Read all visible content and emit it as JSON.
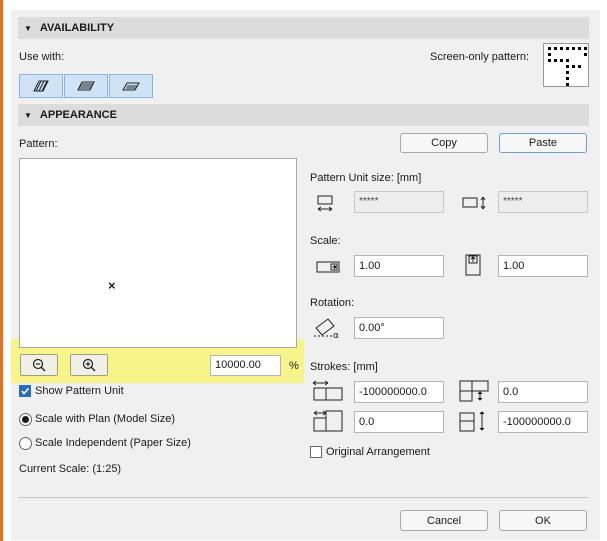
{
  "availability": {
    "header": "AVAILABILITY",
    "use_with_label": "Use with:",
    "use_with_icons": [
      "fill-cut-icon",
      "fill-cover-icon",
      "fill-surface-icon"
    ],
    "screen_only_label": "Screen-only pattern:"
  },
  "appearance": {
    "header": "APPEARANCE",
    "pattern_label": "Pattern:",
    "copy_label": "Copy",
    "paste_label": "Paste",
    "zoom_value": "10000.00",
    "zoom_unit": "%",
    "show_pattern_unit": "Show Pattern Unit",
    "scale_with_plan": "Scale with Plan (Model Size)",
    "scale_independent": "Scale Independent (Paper Size)",
    "current_scale": "Current Scale: (1:25)"
  },
  "right": {
    "unit_size_label": "Pattern Unit size: [mm]",
    "unit_width": "*****",
    "unit_height": "*****",
    "scale_label": "Scale:",
    "scale_x": "1.00",
    "scale_y": "1.00",
    "rotation_label": "Rotation:",
    "rotation": "0.00°",
    "strokes_label": "Strokes: [mm]",
    "stroke_1": "-100000000.0",
    "stroke_2": "0.0",
    "stroke_3": "0.0",
    "stroke_4": "-100000000.0",
    "original_arrangement": "Original Arrangement"
  },
  "footer": {
    "cancel_label": "Cancel",
    "ok_label": "OK"
  },
  "colors": {
    "highlight": "#f7f48a",
    "segment_active": "#cfe3f7",
    "accent": "#2a6ebb"
  }
}
